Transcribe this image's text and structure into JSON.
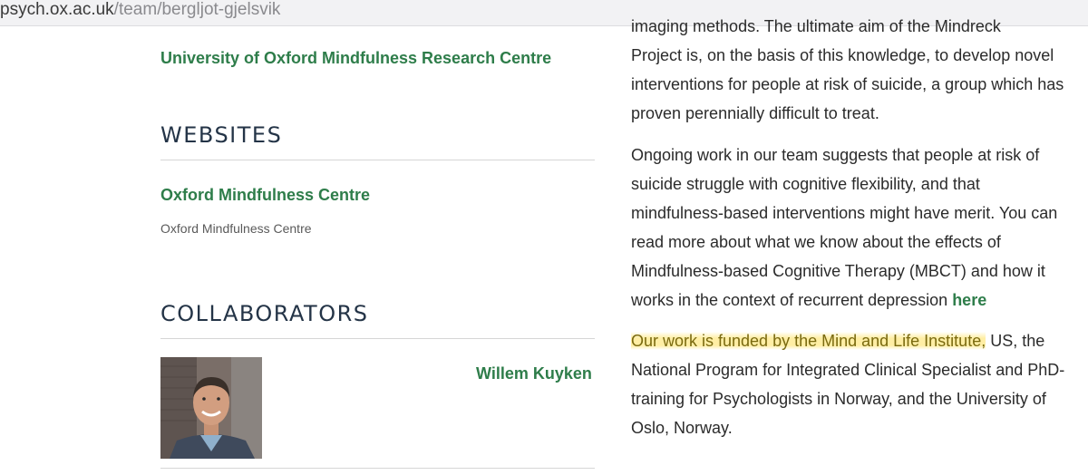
{
  "browser": {
    "url_domain": "psych.ox.ac.uk",
    "url_path": "/team/bergljot-gjelsvik"
  },
  "left": {
    "top_link": "University of Oxford Mindfulness Research Centre",
    "websites": {
      "heading": "WEBSITES",
      "link_title": "Oxford Mindfulness Centre",
      "link_caption": "Oxford Mindfulness Centre"
    },
    "collaborators": {
      "heading": "COLLABORATORS",
      "items": [
        {
          "name": "Willem Kuyken"
        }
      ]
    }
  },
  "right": {
    "cut_top_line": "imaging methods. The ultimate aim of the Mindreck",
    "para1": "Project is, on the basis of this knowledge, to develop novel interventions for people at risk of suicide, a group which has proven perennially difficult to treat.",
    "para2_text": "Ongoing work in our team suggests that people at risk of suicide struggle with cognitive flexibility, and that mindfulness-based interventions might have merit. You can read more about what we know about the effects of Mindfulness-based Cognitive Therapy (MBCT) and how it works in the context of recurrent depression",
    "para2_link": "here",
    "para3_highlight": "Our work is funded by the Mind and Life Institute,",
    "para3_rest": "US, the National Program for Integrated Clinical Specialist and PhD-training for Psychologists in Norway, and the University of Oslo, Norway."
  },
  "colors": {
    "link_green": "#2e7d4a",
    "heading_navy": "#243447",
    "highlight_yellow": "#ffe15a"
  }
}
